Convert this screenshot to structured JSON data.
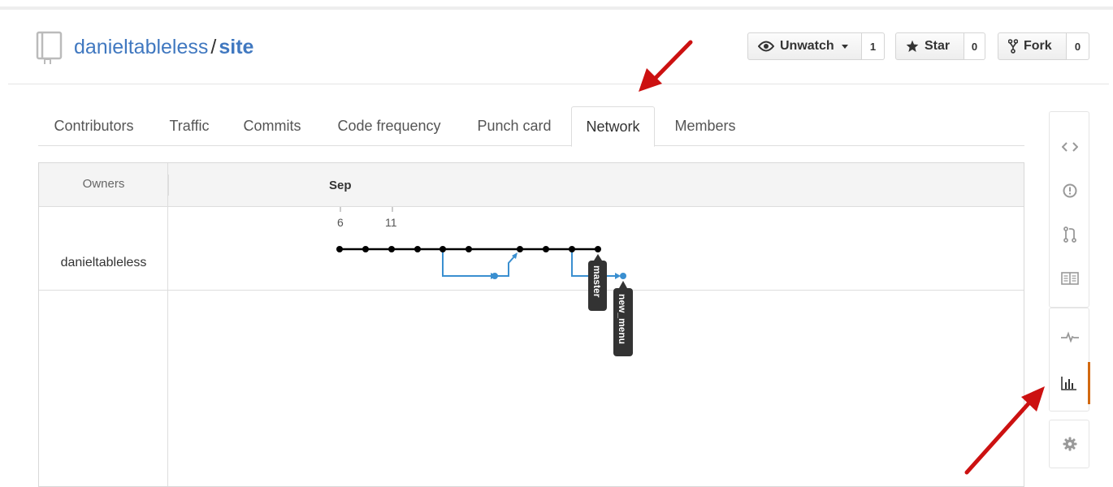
{
  "repo": {
    "owner": "danieltableless",
    "separator": "/",
    "name": "site"
  },
  "actions": [
    {
      "label": "Unwatch",
      "count": "1",
      "icon": "eye-icon"
    },
    {
      "label": "Star",
      "count": "0",
      "icon": "star-icon"
    },
    {
      "label": "Fork",
      "count": "0",
      "icon": "fork-icon"
    }
  ],
  "tabs": [
    {
      "label": "Contributors",
      "active": false
    },
    {
      "label": "Traffic",
      "active": false
    },
    {
      "label": "Commits",
      "active": false
    },
    {
      "label": "Code frequency",
      "active": false
    },
    {
      "label": "Punch card",
      "active": false
    },
    {
      "label": "Network",
      "active": true
    },
    {
      "label": "Members",
      "active": false
    }
  ],
  "network": {
    "owners_header": "Owners",
    "month": "Sep",
    "days": [
      "6",
      "11"
    ],
    "owner": "danieltableless",
    "branches": [
      {
        "name": "master",
        "color": "#000000"
      },
      {
        "name": "new_menu",
        "color": "#3a8fd0"
      }
    ]
  },
  "sidebar": [
    {
      "icon": "code-icon",
      "active": false
    },
    {
      "icon": "issue-icon",
      "active": false
    },
    {
      "icon": "pull-request-icon",
      "active": false
    },
    {
      "icon": "wiki-icon",
      "active": false
    },
    {
      "icon": "pulse-icon",
      "active": false
    },
    {
      "icon": "graph-icon",
      "active": true
    },
    {
      "icon": "settings-icon",
      "active": false
    }
  ],
  "colors": {
    "link": "#4078c0",
    "active_accent": "#d26911",
    "annotation_arrow": "#cc1111"
  }
}
